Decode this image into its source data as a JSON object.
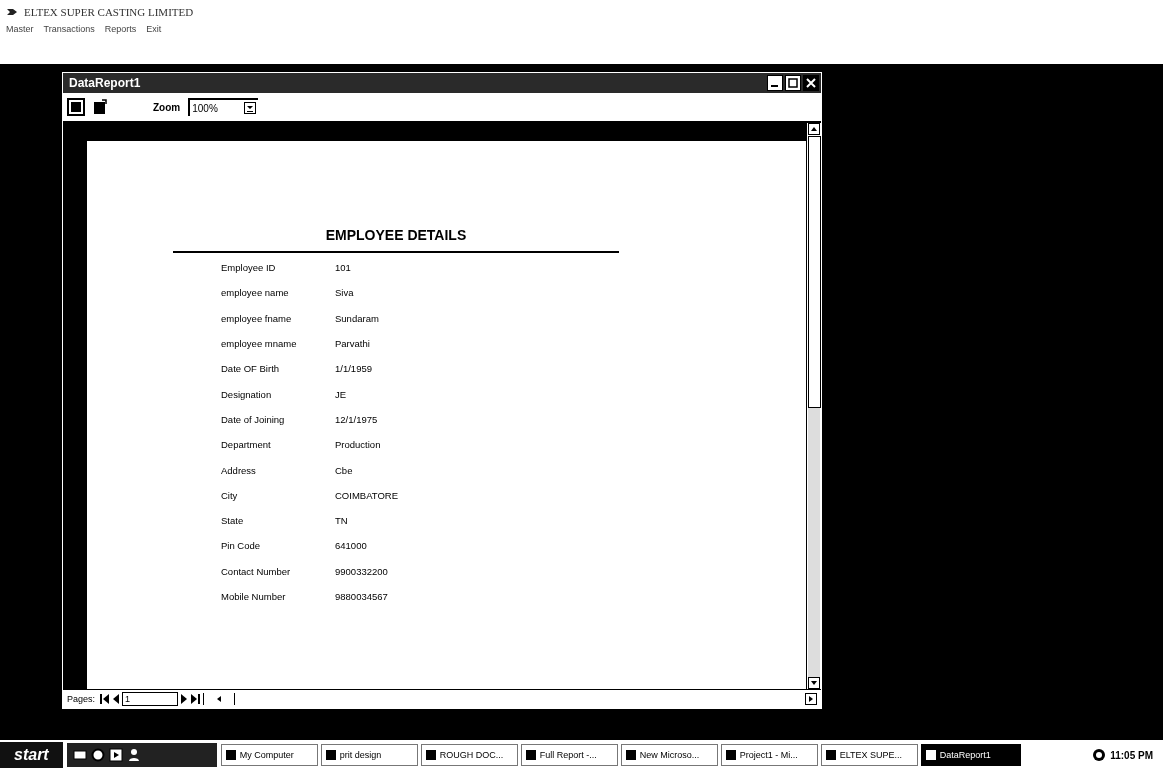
{
  "app": {
    "title": "ELTEX SUPER CASTING LIMITED"
  },
  "menu": [
    {
      "label": "Master"
    },
    {
      "label": "Transactions"
    },
    {
      "label": "Reports"
    },
    {
      "label": "Exit"
    }
  ],
  "report_window": {
    "title": "DataReport1",
    "zoom_label": "Zoom",
    "zoom_value": "100%",
    "pages_label": "Pages:",
    "page_value": "1"
  },
  "report": {
    "heading": "EMPLOYEE DETAILS",
    "fields": [
      {
        "label": "Employee ID",
        "value": "101"
      },
      {
        "label": "employee name",
        "value": "Siva"
      },
      {
        "label": "employee fname",
        "value": "Sundaram"
      },
      {
        "label": "employee mname",
        "value": "Parvathi"
      },
      {
        "label": "Date OF Birth",
        "value": "1/1/1959"
      },
      {
        "label": "Designation",
        "value": "JE"
      },
      {
        "label": "Date of Joining",
        "value": "12/1/1975"
      },
      {
        "label": "Department",
        "value": "Production"
      },
      {
        "label": "Address",
        "value": "Cbe"
      },
      {
        "label": "City",
        "value": "COIMBATORE"
      },
      {
        "label": "State",
        "value": "TN"
      },
      {
        "label": "Pin Code",
        "value": "641000"
      },
      {
        "label": "Contact Number",
        "value": "9900332200"
      },
      {
        "label": "Mobile Number",
        "value": "9880034567"
      }
    ]
  },
  "taskbar": {
    "start": "start",
    "tasks": [
      {
        "label": "My Computer",
        "selected": false
      },
      {
        "label": "prit design",
        "selected": false
      },
      {
        "label": "ROUGH DOC...",
        "selected": false
      },
      {
        "label": "Full Report -...",
        "selected": false
      },
      {
        "label": "New Microso...",
        "selected": false
      },
      {
        "label": "Project1 - Mi...",
        "selected": false
      },
      {
        "label": "ELTEX SUPE...",
        "selected": false
      },
      {
        "label": "DataReport1",
        "selected": true
      }
    ],
    "clock": "11:05 PM"
  }
}
